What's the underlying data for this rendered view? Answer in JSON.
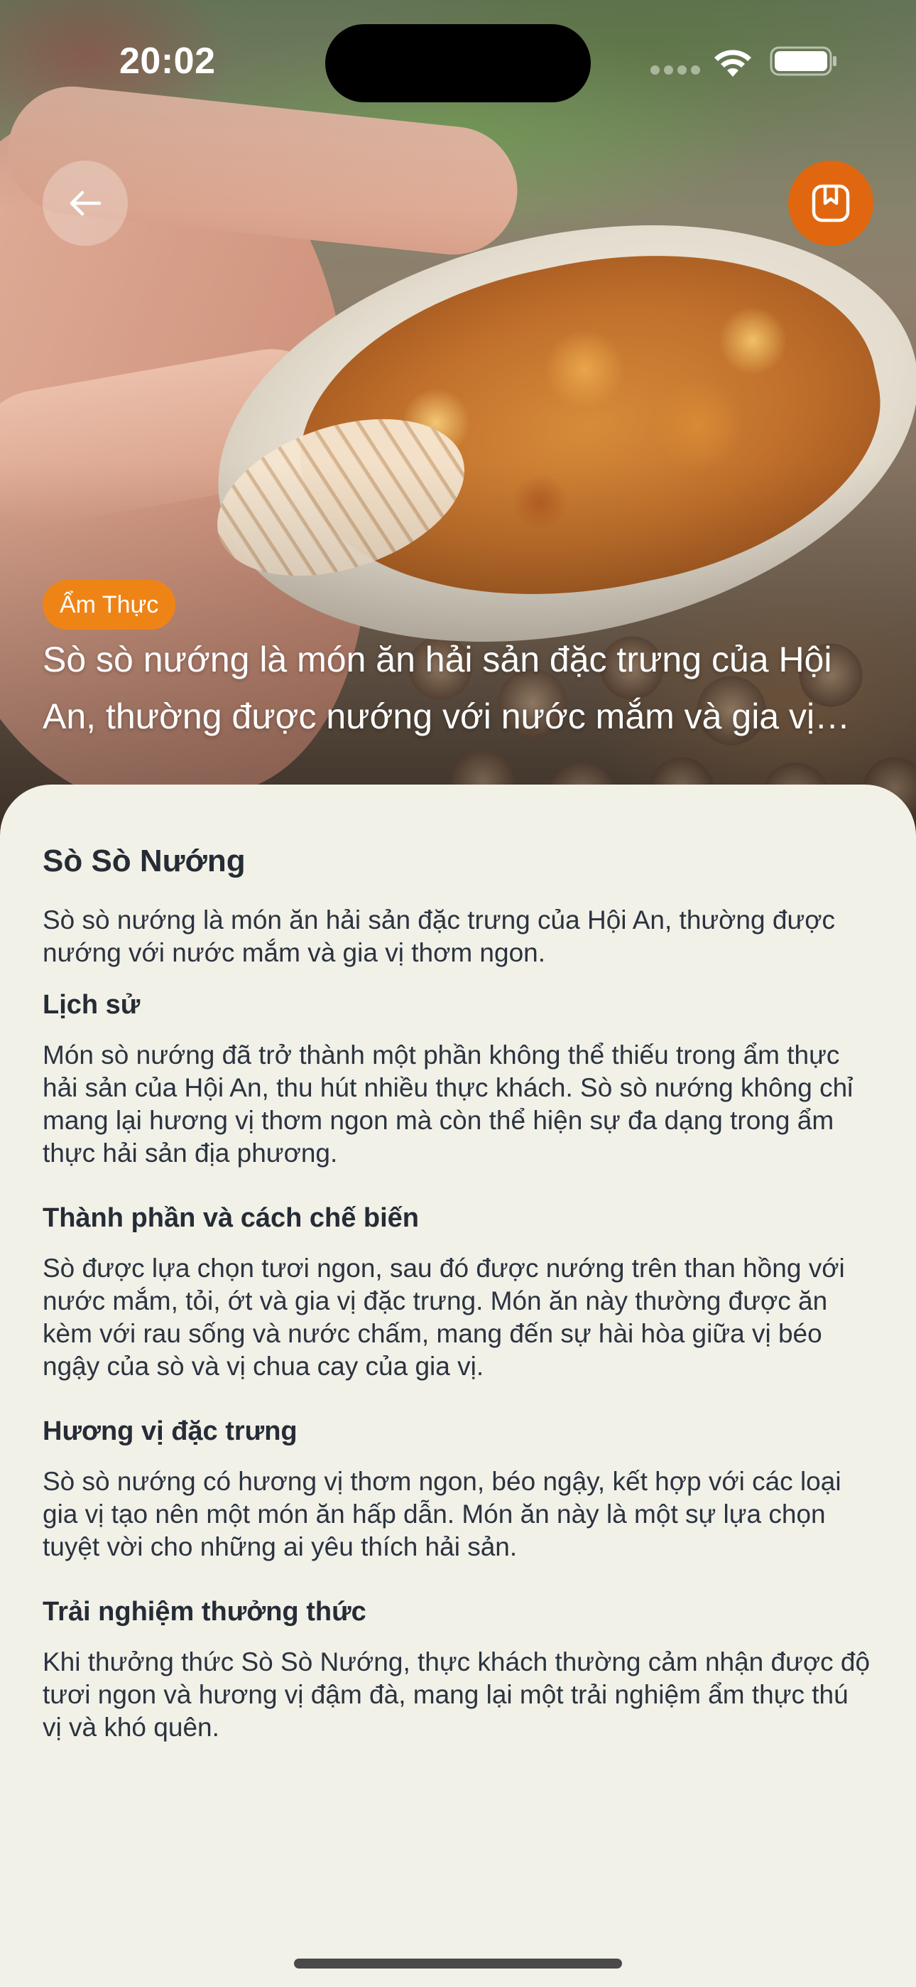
{
  "status_bar": {
    "time": "20:02",
    "wifi_icon": "wifi-icon",
    "battery_icon": "battery-icon"
  },
  "hero": {
    "image_icon": "food-photo",
    "back_icon": "arrow-left-icon",
    "bookmark_icon": "bookmark-icon",
    "category": "Ẩm Thực",
    "summary": "Sò sò nướng là món ăn hải sản đặc trưng của Hội An, thường được nướng với nước mắm và gia vị thơm ngon."
  },
  "article": {
    "title": "Sò Sò Nướng",
    "intro": "Sò sò nướng là món ăn hải sản đặc trưng của Hội An, thường được nướng với nước mắm và gia vị thơm ngon.",
    "sections": [
      {
        "heading": "Lịch sử",
        "body": "Món sò nướng đã trở thành một phần không thể thiếu trong ẩm thực hải sản của Hội An, thu hút nhiều thực khách. Sò sò nướng không chỉ mang lại hương vị thơm ngon mà còn thể hiện sự đa dạng trong ẩm thực hải sản địa phương."
      },
      {
        "heading": "Thành phần và cách chế biến",
        "body": "Sò được lựa chọn tươi ngon, sau đó được nướng trên than hồng với nước mắm, tỏi, ớt và gia vị đặc trưng. Món ăn này thường được ăn kèm với rau sống và nước chấm, mang đến sự hài hòa giữa vị béo ngậy của sò và vị chua cay của gia vị."
      },
      {
        "heading": "Hương vị đặc trưng",
        "body": "Sò sò nướng có hương vị thơm ngon, béo ngậy, kết hợp với các loại gia vị tạo nên một món ăn hấp dẫn. Món ăn này là một sự lựa chọn tuyệt vời cho những ai yêu thích hải sản."
      },
      {
        "heading": "Trải nghiệm thưởng thức",
        "body": "Khi thưởng thức Sò Sò Nướng, thực khách thường cảm nhận được độ tươi ngon và hương vị đậm đà, mang lại một trải nghiệm ẩm thực thú vị và khó quên."
      }
    ]
  },
  "colors": {
    "accent": "#e0670f",
    "badge": "#ef8416",
    "background": "#f2f1e8",
    "text": "#2b3340"
  }
}
